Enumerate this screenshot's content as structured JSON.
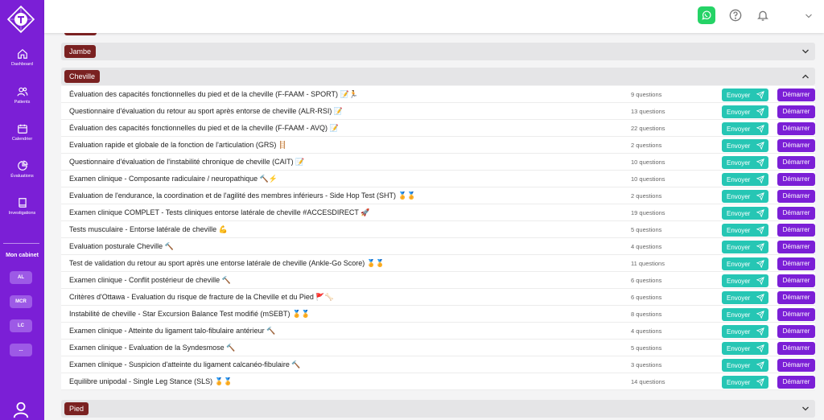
{
  "sidebar": {
    "nav": [
      {
        "label": "Dashboard",
        "icon": "home-icon"
      },
      {
        "label": "Patients",
        "icon": "users-icon"
      },
      {
        "label": "Calendrier",
        "icon": "calendar-icon"
      },
      {
        "label": "Évaluations",
        "icon": "chart-pie-icon"
      },
      {
        "label": "Investigations",
        "icon": "book-icon"
      }
    ],
    "cabinet_title": "Mon cabinet",
    "cabinet_chips": [
      "AL",
      "MCR",
      "LC",
      "..."
    ]
  },
  "sections": {
    "jambe": "Jambe",
    "cheville": "Cheville",
    "pied": "Pied"
  },
  "buttons": {
    "send": "Envoyer",
    "start": "Démarrer"
  },
  "rows": [
    {
      "title": "Évaluation des capacités fonctionnelles du pied et de la cheville (F-FAAM - SPORT) 📝🏃",
      "questions": "9 questions"
    },
    {
      "title": "Questionnaire d'évaluation du retour au sport après entorse de cheville (ALR-RSI) 📝",
      "questions": "13 questions"
    },
    {
      "title": "Évaluation des capacités fonctionnelles du pied et de la cheville (F-FAAM - AVQ) 📝",
      "questions": "22 questions"
    },
    {
      "title": "Evaluation rapide et globale de la fonction de l'articulation (GRS) 🪜",
      "questions": "2 questions"
    },
    {
      "title": "Questionnaire d'évaluation de l'instabilité chronique de cheville (CAIT) 📝",
      "questions": "10 questions"
    },
    {
      "title": "Examen clinique - Composante radiculaire / neuropathique 🔨⚡",
      "questions": "10 questions"
    },
    {
      "title": "Evaluation de l'endurance, la coordination et de l'agilité des membres inférieurs - Side Hop Test (SHT) 🏅🏅",
      "questions": "2 questions"
    },
    {
      "title": "Examen clinique COMPLET - Tests cliniques entorse latérale de cheville #ACCESDIRECT 🚀",
      "questions": "19 questions"
    },
    {
      "title": "Tests musculaire - Entorse latérale de cheville 💪",
      "questions": "5 questions"
    },
    {
      "title": "Evaluation posturale Cheville 🔨",
      "questions": "4 questions"
    },
    {
      "title": "Test de validation du retour au sport après une entorse latérale de cheville (Ankle-Go Score) 🏅🏅",
      "questions": "11 questions"
    },
    {
      "title": "Examen clinique - Conflit postérieur de cheville 🔨",
      "questions": "6 questions"
    },
    {
      "title": "Critères d'Ottawa - Evaluation du risque de fracture de la Cheville et du Pied 🚩🦴",
      "questions": "6 questions"
    },
    {
      "title": "Instabilité de cheville - Star Excursion Balance Test modifié (mSEBT) 🏅🏅",
      "questions": "8 questions"
    },
    {
      "title": "Examen clinique - Atteinte du ligament talo-fibulaire antérieur 🔨",
      "questions": "4 questions"
    },
    {
      "title": "Examen clinique - Evaluation de la Syndesmose 🔨",
      "questions": "5 questions"
    },
    {
      "title": "Examen clinique - Suspicion d'atteinte du ligament calcanéo-fibulaire 🔨",
      "questions": "3 questions"
    },
    {
      "title": "Equilibre unipodal - Single Leg Stance (SLS) 🏅🏅",
      "questions": "14 questions"
    }
  ],
  "colors": {
    "primary": "#7b1fd6",
    "send": "#26c6b4",
    "pill": "#7a2121"
  }
}
